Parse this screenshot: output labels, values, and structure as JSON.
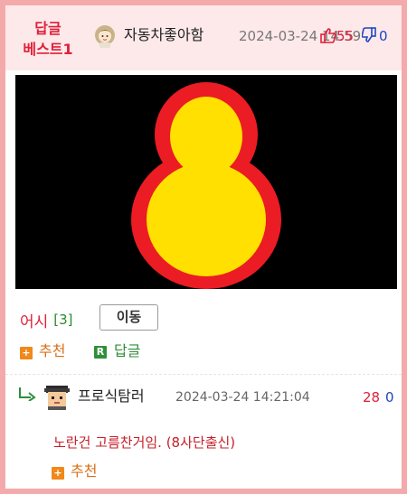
{
  "header": {
    "best_label_line1": "답글",
    "best_label_line2": "베스트1",
    "author": "자동차좋아함",
    "date": "2024-03-24 14:59",
    "upvotes": "55",
    "downvotes": "0"
  },
  "post": {
    "game_title": "어시",
    "comment_count": "[3]",
    "move_label": "이동",
    "recommend_label": "추천",
    "reply_label": "답글"
  },
  "reply": {
    "author": "프로식탐러",
    "date": "2024-03-24 14:21:04",
    "upvotes": "28",
    "downvotes": "0",
    "text": "노란건 고름찬거임. (8사단출신)",
    "recommend_label": "추천"
  },
  "icons": {
    "avatar_author": "girl-avatar-icon",
    "avatar_reply": "pixel-face-avatar-icon",
    "thumbs_up": "thumbs-up-icon",
    "thumbs_down": "thumbs-down-icon",
    "plus": "plus-icon",
    "reply_badge": "r-badge-icon",
    "reply_arrow": "reply-arrow-icon"
  },
  "colors": {
    "frame_border": "#f4a9ab",
    "header_bg": "#fde9ea",
    "accent_red": "#e0203a",
    "downvote_blue": "#1d46c2",
    "recommend_orange": "#d9701a",
    "reply_green": "#2f8f3a",
    "eight_fill": "#ffe000",
    "eight_outline": "#ec1c24"
  }
}
